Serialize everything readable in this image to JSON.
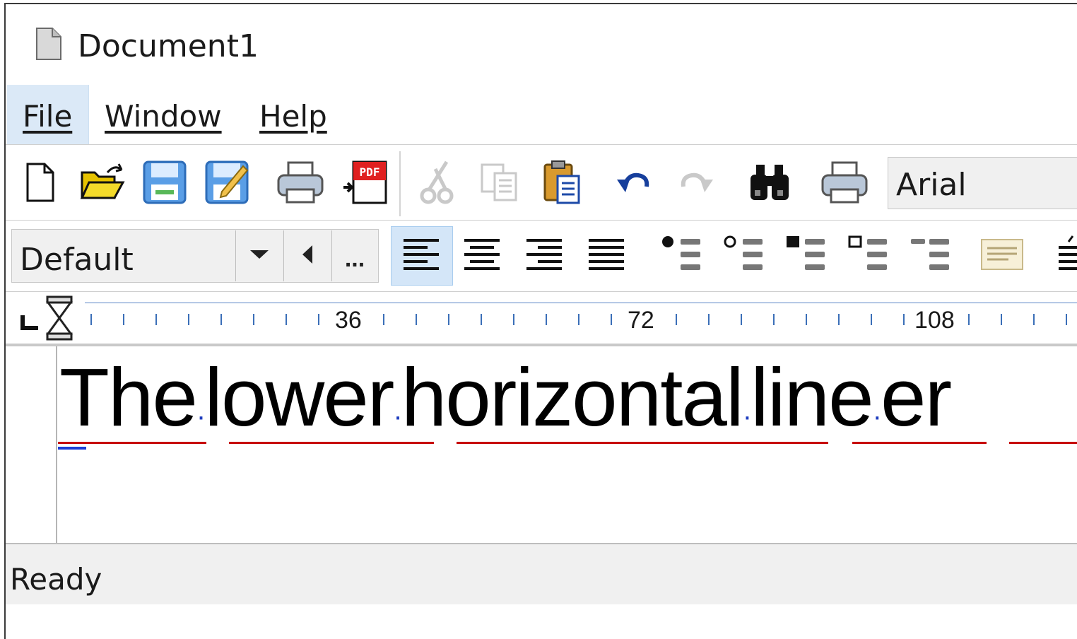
{
  "window": {
    "title": "Document1"
  },
  "menu": {
    "file": "File",
    "window": "Window",
    "help": "Help"
  },
  "toolbar": {
    "icons": [
      "new-document-icon",
      "open-folder-icon",
      "save-icon",
      "save-as-icon",
      "print-icon",
      "export-pdf-icon",
      "cut-icon",
      "copy-icon",
      "paste-icon",
      "undo-icon",
      "redo-icon",
      "find-icon",
      "print-preview-icon"
    ],
    "pdf_label": "PDF",
    "font_name": "Arial"
  },
  "format_bar": {
    "paragraph_style": "Default",
    "more_label": "..."
  },
  "ruler": {
    "labels": [
      "36",
      "72",
      "108"
    ]
  },
  "document": {
    "words": [
      "The",
      "lower",
      "horizontal",
      "line",
      "er"
    ],
    "space_marker": "·"
  },
  "status": {
    "text": "Ready"
  },
  "colors": {
    "selection": "#dbe9f7",
    "spell_underline": "#c60000",
    "ruler_ticks": "#3b6fb8"
  }
}
